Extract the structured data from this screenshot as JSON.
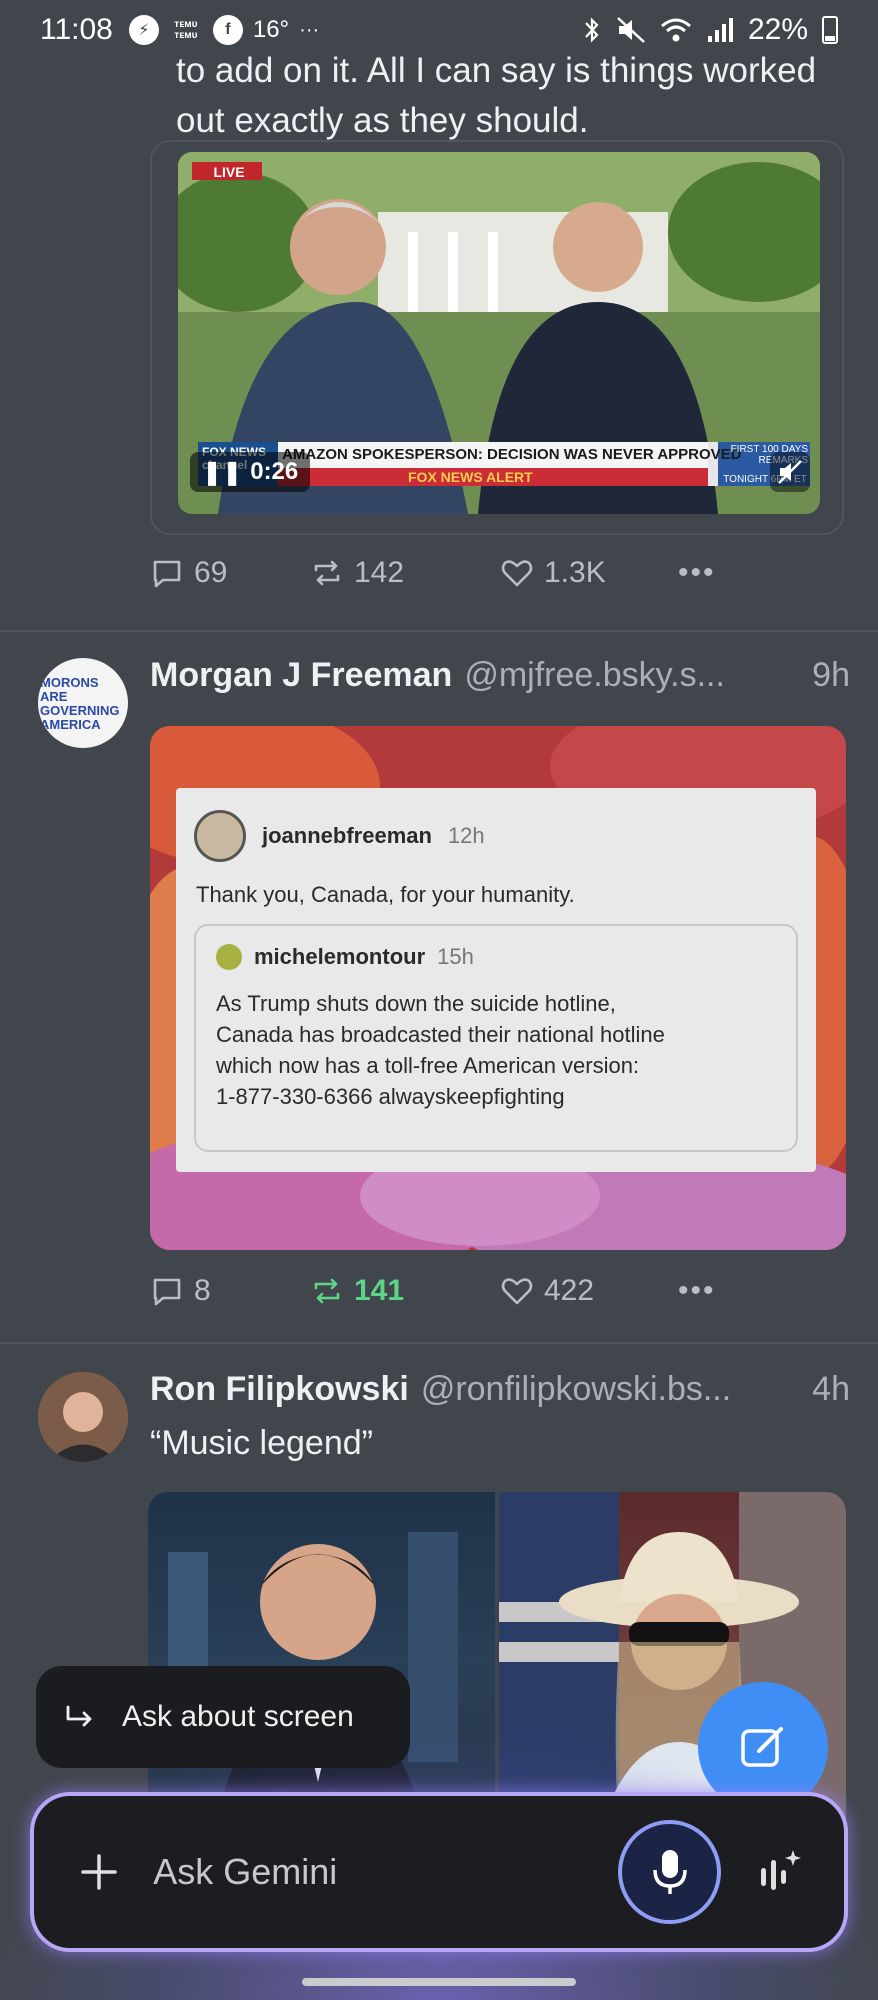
{
  "status_bar": {
    "time": "11:08",
    "temu_1": "ᴛᴇᴍᴜ ᴛᴇᴍᴜ",
    "temperature": "16°",
    "more": "···",
    "battery": "22%"
  },
  "post1": {
    "text": "to add on it. All I can say is things worked out exactly as they should.",
    "video": {
      "live_badge": "LIVE",
      "headline": "AMAZON SPOKESPERSON: DECISION WAS NEVER APPROVED",
      "ticker": "FOX NEWS ALERT",
      "network": "FOX NEWS channel",
      "side_promo": "FIRST 100 DAYS REMARKS",
      "side_time": "TONIGHT 6PM ET",
      "timestamp": "0:26"
    },
    "replies": "69",
    "reposts": "142",
    "likes": "1.3K"
  },
  "post2": {
    "avatar_text": "MORONS ARE GOVERNING AMERICA",
    "name": "Morgan J Freeman",
    "handle": "@mjfree.bsky.s...",
    "time": "9h",
    "embed": {
      "user": "joannebfreeman",
      "time": "12h",
      "text": "Thank you, Canada, for your humanity.",
      "quote_user": "michelemontour",
      "quote_time": "15h",
      "quote_text": "As Trump shuts down the suicide hotline,\nCanada has broadcasted their national hotline\nwhich now has a toll-free American version:\n1-877-330-6366 alwayskeepfighting"
    },
    "replies": "8",
    "reposts": "141",
    "likes": "422"
  },
  "post3": {
    "name": "Ron Filipkowski",
    "handle": "@ronfilipkowski.bs...",
    "time": "4h",
    "text": "“Music legend”"
  },
  "gemini": {
    "ask_screen": "Ask about screen",
    "placeholder": "Ask Gemini"
  },
  "colors": {
    "background": "#41464c",
    "repost_active": "#5cd48a",
    "fab": "#3f8ef5",
    "gemini_border": "#b7a6f5"
  }
}
